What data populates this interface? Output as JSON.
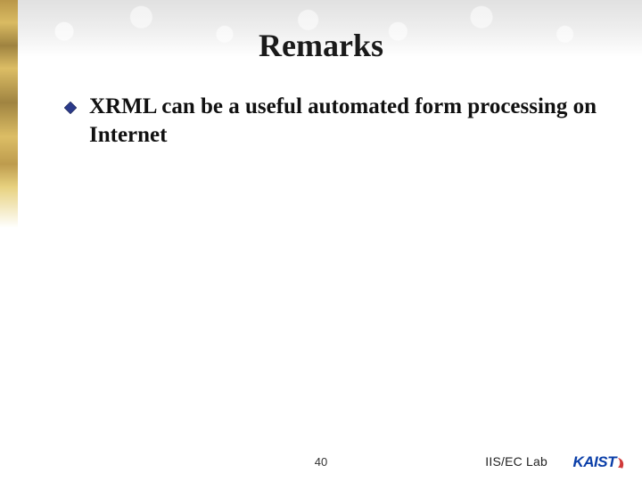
{
  "title": "Remarks",
  "bullets": [
    {
      "text": "XRML can be a useful automated form processing on Internet"
    }
  ],
  "footer": {
    "page_number": "40",
    "lab_label": "IIS/EC Lab",
    "org_logo_text": "KAIST"
  },
  "colors": {
    "accent_gold": "#b28a2e",
    "bullet_fill": "#2b3a8a",
    "logo_blue": "#0a3ea8"
  }
}
